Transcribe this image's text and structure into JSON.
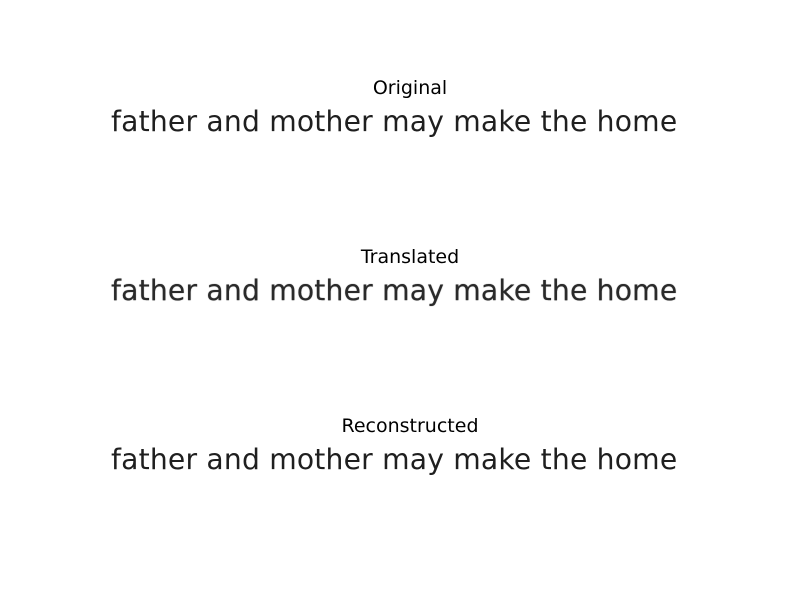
{
  "panels": [
    {
      "title": "Original",
      "text": "father and mother may make the home"
    },
    {
      "title": "Translated",
      "text": "father and mother may make the home"
    },
    {
      "title": "Reconstructed",
      "text": "father and mother may make the home"
    }
  ]
}
